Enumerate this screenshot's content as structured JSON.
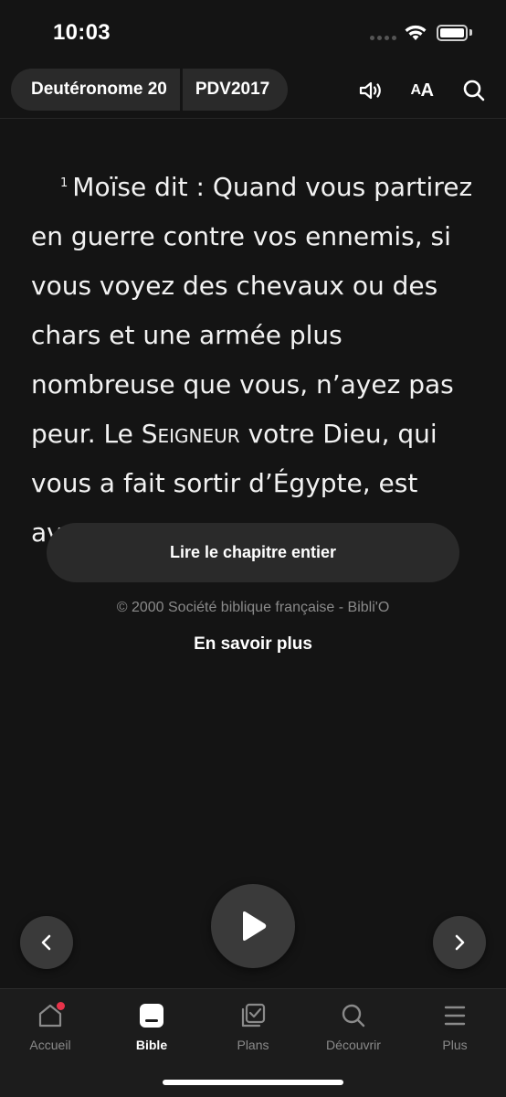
{
  "status_bar": {
    "time": "10:03"
  },
  "header": {
    "book": "Deutéronome 20",
    "version": "PDV2017",
    "icons": [
      "speaker-icon",
      "text-size-icon",
      "search-icon"
    ],
    "text_size_label_big": "A",
    "text_size_label_small": "A"
  },
  "verse": {
    "number": "1",
    "text_before": "Moïse dit : Quand vous partirez en guerre contre vos ennemis, si vous voyez des chevaux ou des chars et une armée plus nombreuse que vous, n’ayez pas peur. Le ",
    "lord": "Seigneur",
    "text_after": " votre Dieu, qui vous a fait sortir d’Égypte, est avec vous."
  },
  "read_chapter_label": "Lire le chapitre entier",
  "copyright": "© 2000 Société biblique française - Bibli'O",
  "learn_more": "En savoir plus",
  "controls": {
    "prev": "chevron-left-icon",
    "play": "play-icon",
    "next": "chevron-right-icon"
  },
  "tabs": [
    {
      "label": "Accueil",
      "icon": "home-icon",
      "badge": true
    },
    {
      "label": "Bible",
      "icon": "bible-icon",
      "active": true
    },
    {
      "label": "Plans",
      "icon": "plans-icon"
    },
    {
      "label": "Découvrir",
      "icon": "search-icon"
    },
    {
      "label": "Plus",
      "icon": "menu-icon"
    }
  ],
  "colors": {
    "background": "#141414",
    "surface": "#2a2a2a",
    "badge": "#e8334a",
    "muted": "#8a8a8a"
  }
}
